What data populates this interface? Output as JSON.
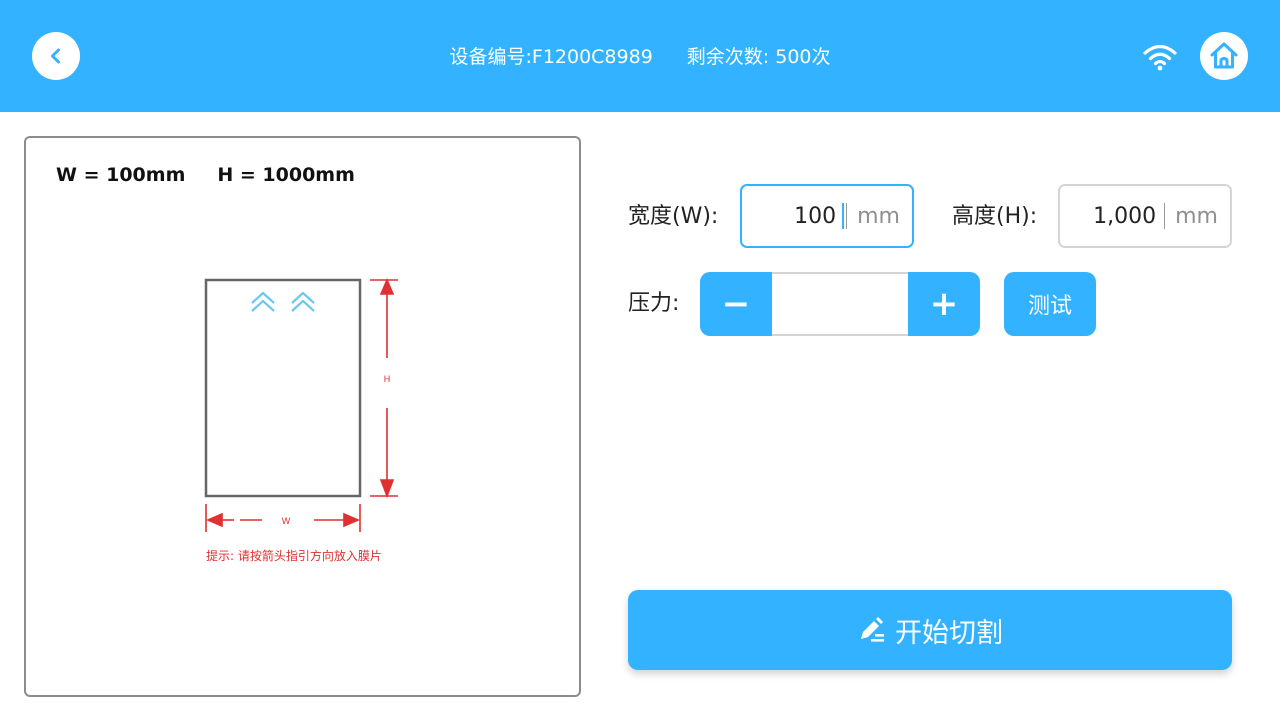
{
  "colors": {
    "accent": "#33b2ff",
    "hint_red": "#e03030",
    "border": "#8c8c8c"
  },
  "header": {
    "device_id": "设备编号:F1200C8989",
    "remaining": "剩余次数: 500次",
    "back_icon": "chevron-left-icon",
    "wifi_icon": "wifi-icon",
    "home_icon": "home-icon"
  },
  "preview": {
    "width_label": "W = 100mm",
    "height_label": "H = 1000mm",
    "diagram": {
      "h_mark": "H",
      "w_mark": "W",
      "hint": "提示: 请按箭头指引方向放入膜片"
    }
  },
  "form": {
    "width": {
      "label": "宽度(W):",
      "value": "100",
      "unit": "mm"
    },
    "height": {
      "label": "高度(H):",
      "value": "1,000",
      "unit": "mm"
    },
    "pressure": {
      "label": "压力:",
      "minus": "−",
      "plus": "+",
      "value": ""
    },
    "test_button": "测试"
  },
  "start_button": {
    "label": "开始切割",
    "icon": "pen-icon"
  }
}
